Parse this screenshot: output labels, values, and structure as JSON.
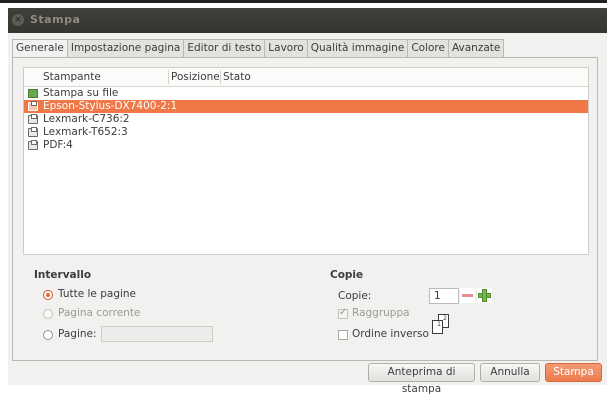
{
  "window": {
    "title": "Stampa",
    "close_icon": "close-icon"
  },
  "tabs": [
    {
      "label": "Generale",
      "active": true
    },
    {
      "label": "Impostazione pagina",
      "active": false
    },
    {
      "label": "Editor di testo",
      "active": false
    },
    {
      "label": "Lavoro",
      "active": false
    },
    {
      "label": "Qualità immagine",
      "active": false
    },
    {
      "label": "Colore",
      "active": false
    },
    {
      "label": "Avanzate",
      "active": false
    }
  ],
  "printer_list": {
    "columns": [
      "Stampante",
      "Posizione",
      "Stato"
    ],
    "rows": [
      {
        "name": "Stampa su file",
        "icon": "file-icon",
        "selected": false
      },
      {
        "name": "Epson-Stylus-DX7400-2:1",
        "icon": "printer-icon",
        "selected": true
      },
      {
        "name": "Lexmark-C736:2",
        "icon": "printer-icon",
        "selected": false
      },
      {
        "name": "Lexmark-T652:3",
        "icon": "printer-icon",
        "selected": false
      },
      {
        "name": "PDF:4",
        "icon": "printer-icon",
        "selected": false
      }
    ]
  },
  "range": {
    "title": "Intervallo",
    "all_pages": "Tutte le pagine",
    "current_page": "Pagina corrente",
    "pages": "Pagine:",
    "pages_value": ""
  },
  "copies": {
    "title": "Copie",
    "label": "Copie:",
    "value": "1",
    "collate": "Raggruppa",
    "collate_checked": true,
    "reverse": "Ordine inverso",
    "reverse_checked": false
  },
  "buttons": {
    "preview": "Anteprima di stampa",
    "cancel": "Annulla",
    "print": "Stampa"
  },
  "colors": {
    "accent": "#f07746",
    "titlebar": "#3c3b37"
  }
}
